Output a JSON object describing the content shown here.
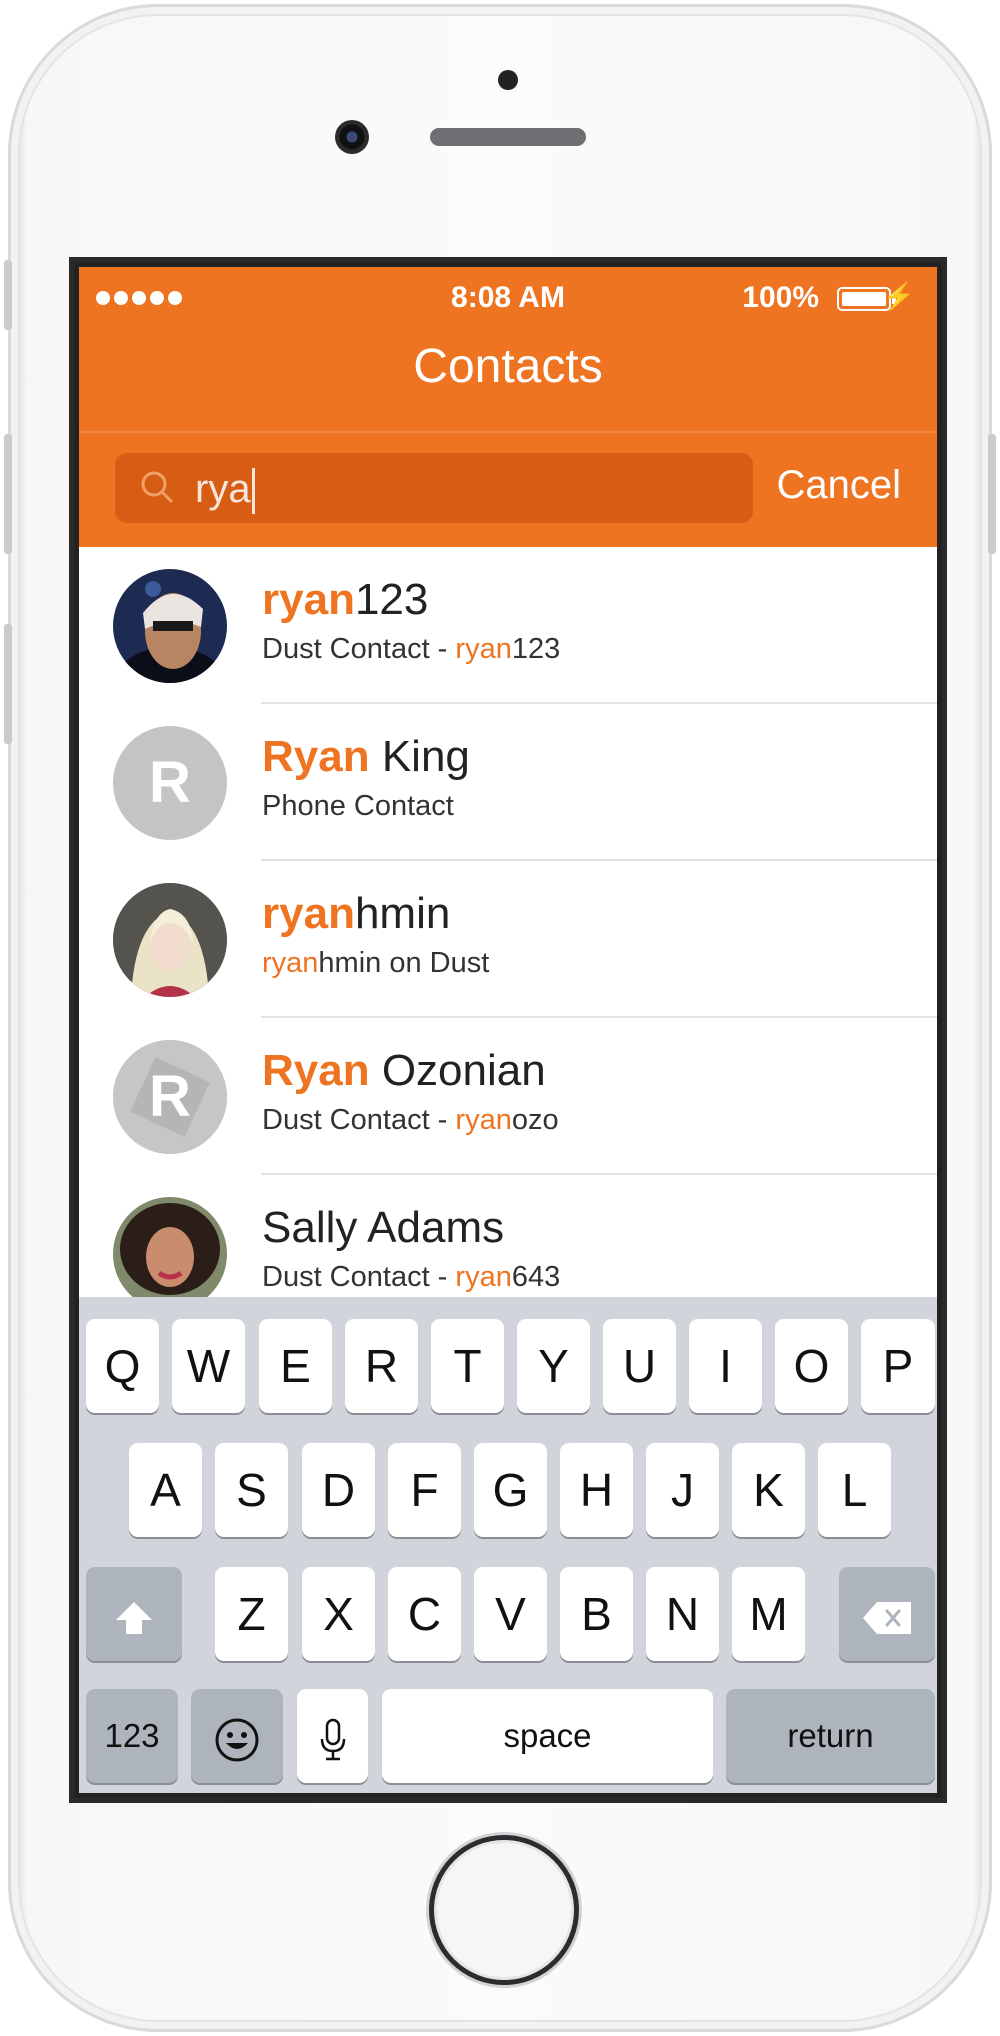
{
  "status_bar": {
    "time": "8:08 AM",
    "battery": "100%",
    "signal_dots": 5
  },
  "nav": {
    "title": "Contacts"
  },
  "search": {
    "query": "rya",
    "cancel_label": "Cancel"
  },
  "contacts": [
    {
      "avatar": "photo-masked-man",
      "name_hl": "ryan",
      "name_rest": "123",
      "sub_pre": "Dust Contact - ",
      "sub_hl": "ryan",
      "sub_post": "123"
    },
    {
      "avatar_letter": "R",
      "name_hl": "Ryan",
      "name_rest": " King",
      "sub_pre": "Phone Contact",
      "sub_hl": "",
      "sub_post": ""
    },
    {
      "avatar": "photo-blonde-woman",
      "name_hl": "ryan",
      "name_rest": "hmin",
      "sub_pre": "",
      "sub_hl": "ryan",
      "sub_post": "hmin on Dust"
    },
    {
      "avatar_letter": "R",
      "name_hl": "Ryan",
      "name_rest": " Ozonian",
      "sub_pre": "Dust Contact - ",
      "sub_hl": "ryan",
      "sub_post": "ozo"
    },
    {
      "avatar": "photo-curly-woman",
      "name_hl": "",
      "name_rest": "Sally Adams",
      "sub_pre": "Dust Contact - ",
      "sub_hl": "ryan",
      "sub_post": "643"
    }
  ],
  "keyboard": {
    "row1": [
      "Q",
      "W",
      "E",
      "R",
      "T",
      "Y",
      "U",
      "I",
      "O",
      "P"
    ],
    "row2": [
      "A",
      "S",
      "D",
      "F",
      "G",
      "H",
      "J",
      "K",
      "L"
    ],
    "row3": [
      "Z",
      "X",
      "C",
      "V",
      "B",
      "N",
      "M"
    ],
    "numbers_label": "123",
    "space_label": "space",
    "return_label": "return",
    "shift_icon": "shift-arrow-icon",
    "delete_icon": "backspace-icon",
    "emoji_icon": "emoji-face-icon",
    "mic_icon": "microphone-icon"
  },
  "colors": {
    "accent": "#ee7421",
    "search_bg": "#d65d13",
    "keyboard_bg": "#d1d5db"
  }
}
